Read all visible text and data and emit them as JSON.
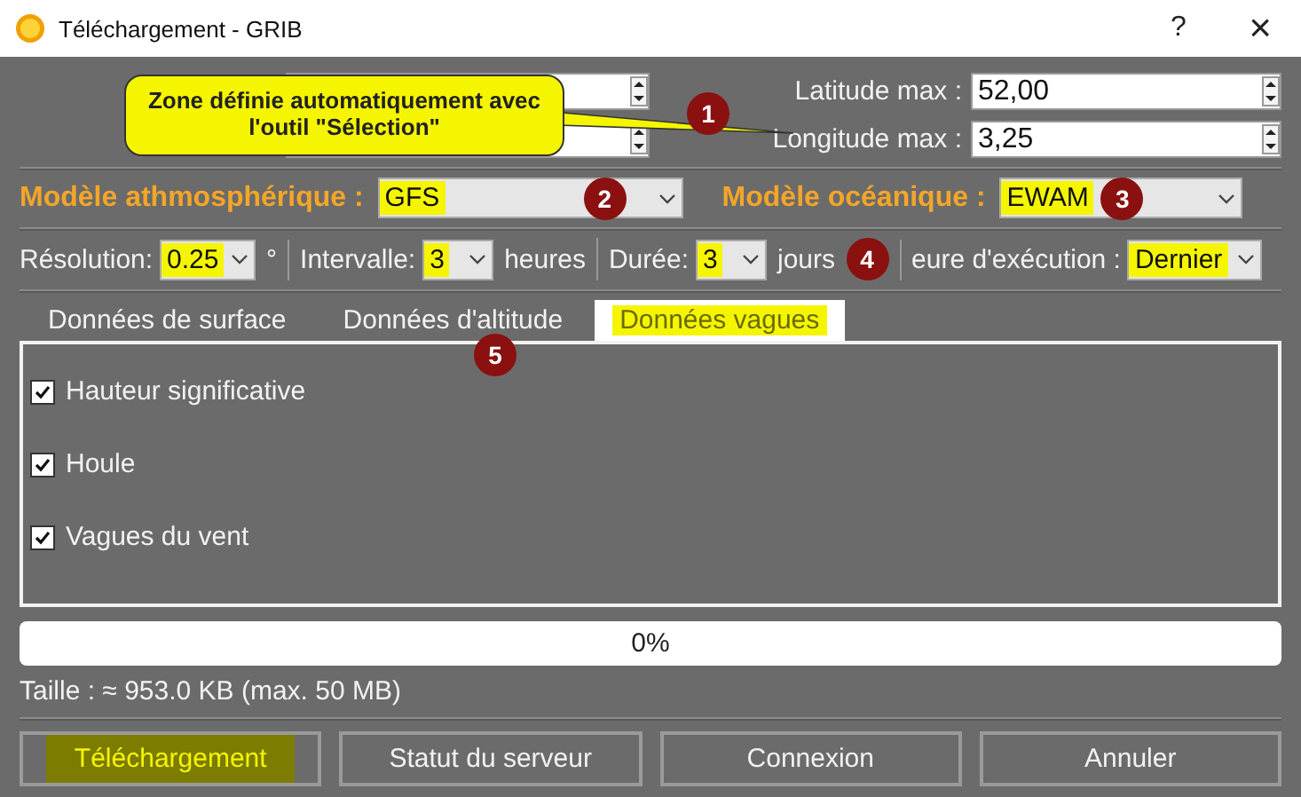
{
  "window": {
    "title": "Téléchargement - GRIB",
    "help": "?",
    "close": "×"
  },
  "callout": {
    "text": "Zone définie automatiquement avec l'outil \"Sélection\""
  },
  "markers": [
    {
      "label": "1"
    },
    {
      "label": "2"
    },
    {
      "label": "3"
    },
    {
      "label": "4"
    },
    {
      "label": "5"
    }
  ],
  "coordinates": {
    "left": [
      {
        "kind": "spinner"
      },
      {
        "kind": "spinner"
      }
    ],
    "right": [
      {
        "label": "Latitude max :",
        "value": "52,00"
      },
      {
        "label": "Longitude max :",
        "value": "3,25"
      }
    ]
  },
  "models": [
    {
      "label": "Modèle athmosphérique :",
      "value": "GFS",
      "highlighted": true
    },
    {
      "label": "Modèle océanique :",
      "value": "EWAM",
      "highlighted": true
    }
  ],
  "options": [
    {
      "label": "Résolution:",
      "value": "0.25",
      "unit": "°",
      "highlighted": true
    },
    {
      "label": "Intervalle:",
      "value": "3",
      "unit": "heures",
      "highlighted": true
    },
    {
      "label": "Durée:",
      "value": "3",
      "unit": "jours",
      "highlighted": true
    },
    {
      "label": "eure d'exécution :",
      "value": "Dernier",
      "highlighted": true
    }
  ],
  "tabs": [
    {
      "label": "Données de surface",
      "selected": false
    },
    {
      "label": "Données d'altitude",
      "selected": false
    },
    {
      "label": "Données vagues",
      "selected": true
    }
  ],
  "checkboxes": [
    {
      "label": "Hauteur significative",
      "checked": true
    },
    {
      "label": "Houle",
      "checked": true
    },
    {
      "label": "Vagues du vent",
      "checked": true
    }
  ],
  "progress": {
    "level": 0,
    "text": "0%"
  },
  "size": "Taille : ≈ 953.0 KB (max. 50 MB)",
  "buttons": [
    {
      "label": "Téléchargement",
      "highlighted": true
    },
    {
      "label": "Statut du serveur",
      "highlighted": false
    },
    {
      "label": "Connexion",
      "highlighted": false
    },
    {
      "label": "Annuler",
      "highlighted": false
    }
  ]
}
